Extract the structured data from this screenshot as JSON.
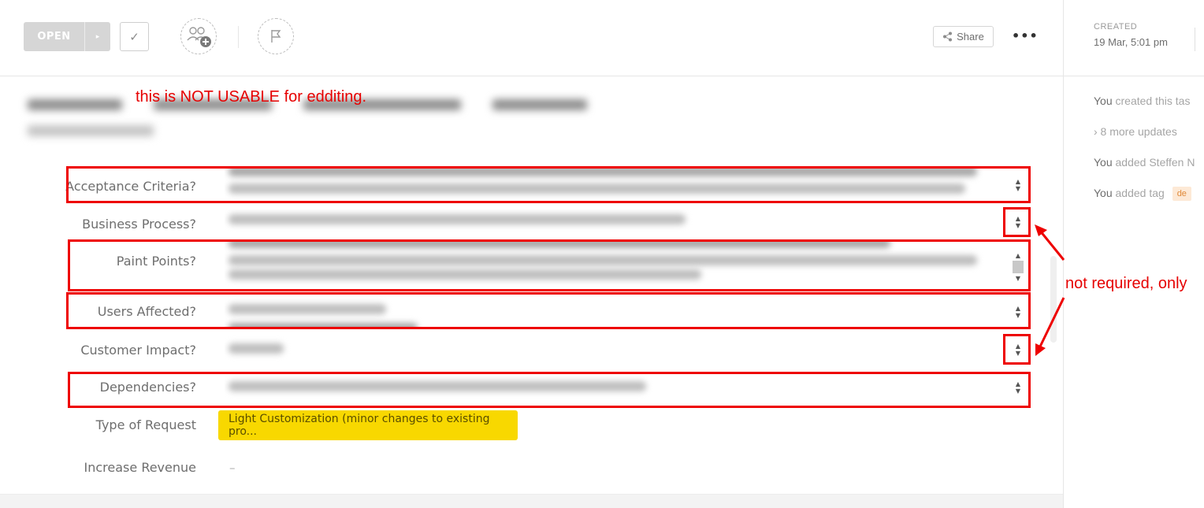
{
  "toolbar": {
    "status_label": "OPEN",
    "status_arrow": "▸",
    "complete_icon": "check-icon",
    "assign_icon": "add-assignee-icon",
    "flag_icon": "flag-icon",
    "share_label": "Share",
    "share_icon": "share-icon",
    "more_label": "•••"
  },
  "sidebar": {
    "created_label": "CREATED",
    "created_value": "19 Mar, 5:01 pm",
    "activity": [
      {
        "actor": "You",
        "text": " created this tas"
      },
      {
        "actor": "",
        "text": "› 8 more updates"
      },
      {
        "actor": "You",
        "text": " added Steffen N"
      },
      {
        "actor": "You",
        "text": " added tag "
      }
    ],
    "tag_label": "de"
  },
  "fields": [
    {
      "label": "Acceptance Criteria?"
    },
    {
      "label": "Business Process?"
    },
    {
      "label": "Paint Points?"
    },
    {
      "label": "Users Affected?"
    },
    {
      "label": "Customer Impact?"
    },
    {
      "label": "Dependencies?"
    },
    {
      "label": "Type of Request",
      "value": "Light Customization (minor changes to existing pro..."
    },
    {
      "label": "Increase Revenue",
      "value": "–"
    }
  ],
  "annotations": {
    "top_note": "this is NOT USABLE for edditing.",
    "side_note": "not required, only",
    "color": "#ee0000"
  }
}
